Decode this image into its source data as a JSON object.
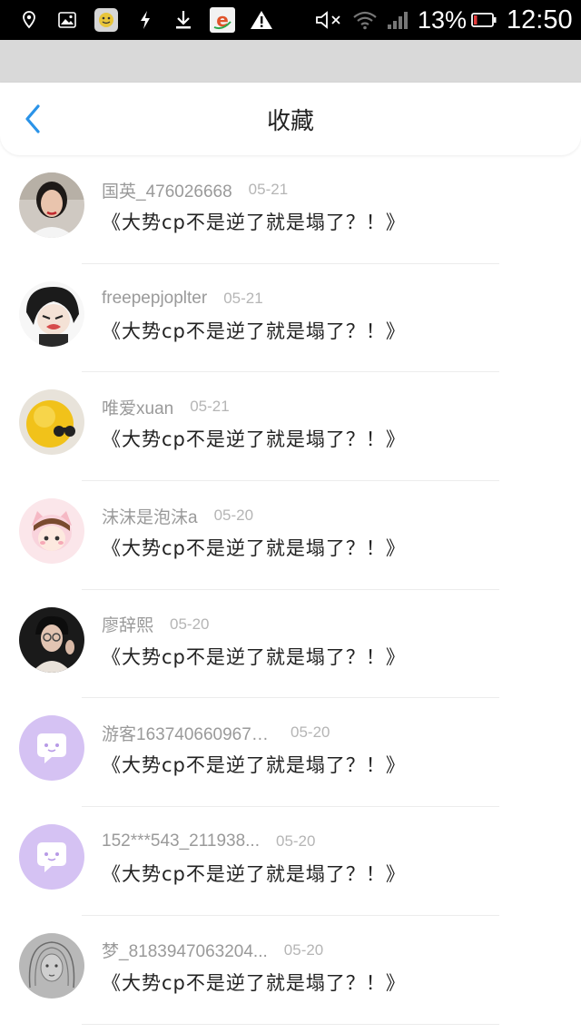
{
  "status_bar": {
    "battery": "13%",
    "time": "12:50"
  },
  "nav": {
    "title": "收藏"
  },
  "items": [
    {
      "user": "国英_476026668",
      "date": "05-21",
      "post": "《大势cp不是逆了就是塌了？！》",
      "avatar": "photo-woman-avatar"
    },
    {
      "user": "freepepjoplter",
      "date": "05-21",
      "post": "《大势cp不是逆了就是塌了？！》",
      "avatar": "anime-character-avatar"
    },
    {
      "user": "唯爱xuan",
      "date": "05-21",
      "post": "《大势cp不是逆了就是塌了？！》",
      "avatar": "yellow-chick-avatar"
    },
    {
      "user": "沫沫是泡沫a",
      "date": "05-20",
      "post": "《大势cp不是逆了就是塌了？！》",
      "avatar": "cartoon-girl-avatar"
    },
    {
      "user": "廖辞熙",
      "date": "05-20",
      "post": "《大势cp不是逆了就是塌了？！》",
      "avatar": "photo-man-avatar"
    },
    {
      "user": "游客1637406609677...",
      "date": "05-20",
      "post": "《大势cp不是逆了就是塌了？！》",
      "avatar": "default-chat-avatar"
    },
    {
      "user": "152***543_211938...",
      "date": "05-20",
      "post": "《大势cp不是逆了就是塌了？！》",
      "avatar": "default-chat-avatar"
    },
    {
      "user": "梦_8183947063204...",
      "date": "05-20",
      "post": "《大势cp不是逆了就是塌了？！》",
      "avatar": "sketch-girl-avatar"
    }
  ]
}
